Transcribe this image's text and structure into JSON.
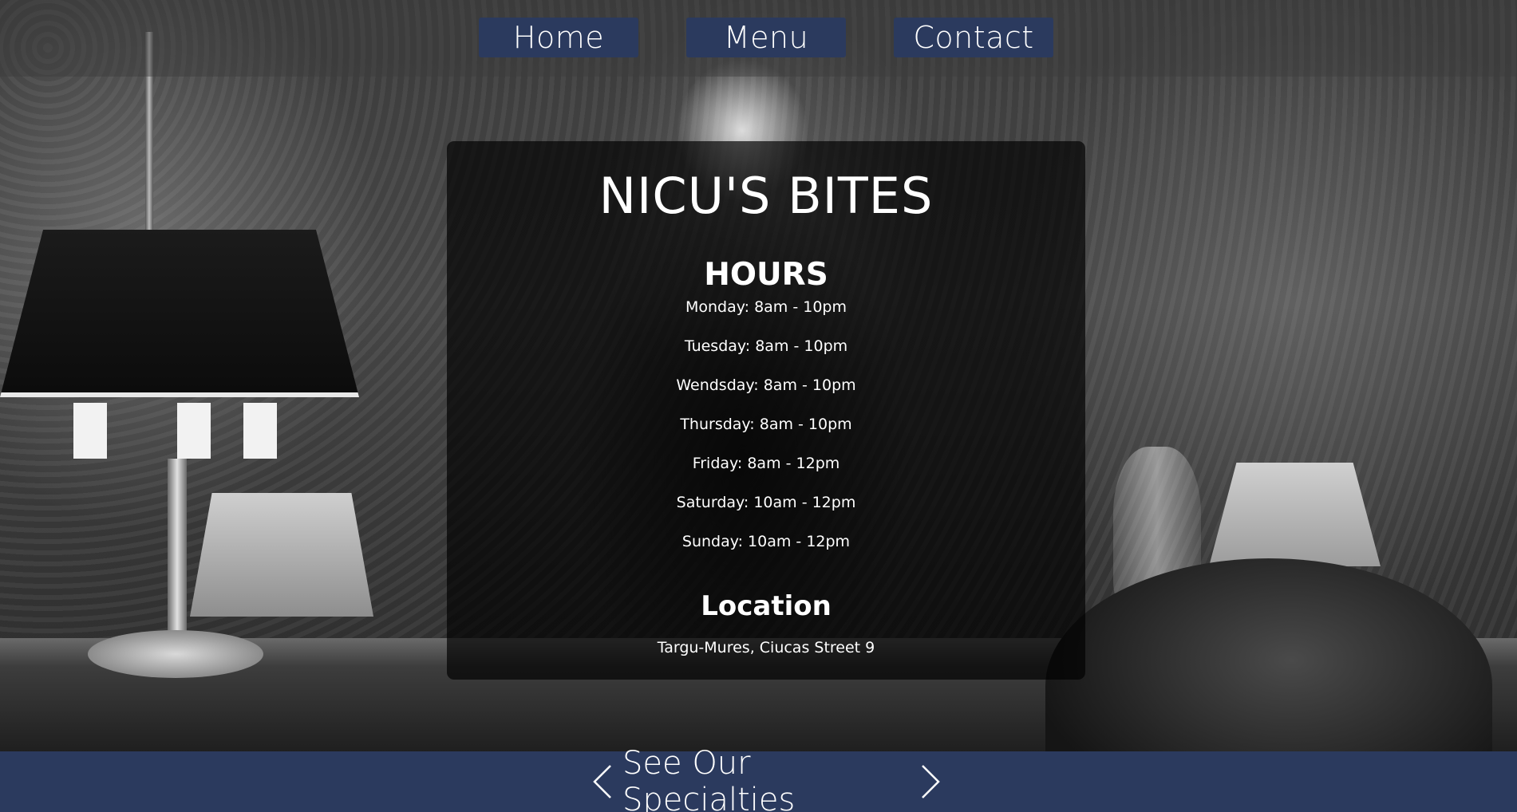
{
  "nav": {
    "home_label": "Home",
    "menu_label": "Menu",
    "contact_label": "Contact"
  },
  "panel": {
    "brand": "NICU'S BITES",
    "hours_title": "HOURS",
    "hours": [
      "Monday: 8am - 10pm",
      "Tuesday: 8am - 10pm",
      "Wendsday: 8am - 10pm",
      "Thursday: 8am - 10pm",
      "Friday: 8am - 12pm",
      "Saturday: 10am - 12pm",
      "Sunday: 10am - 12pm"
    ],
    "location_title": "Location",
    "location_text": "Targu-Mures, Ciucas Street 9"
  },
  "footer": {
    "label": "See Our Specialties",
    "left_icon": "chevron-left-icon",
    "right_icon": "chevron-right-icon"
  },
  "colors": {
    "nav_button_bg": "#2b3a5e",
    "footer_bg": "#2b3a5e",
    "panel_bg": "rgba(0,0,0,0.68)",
    "text": "#ffffff"
  }
}
